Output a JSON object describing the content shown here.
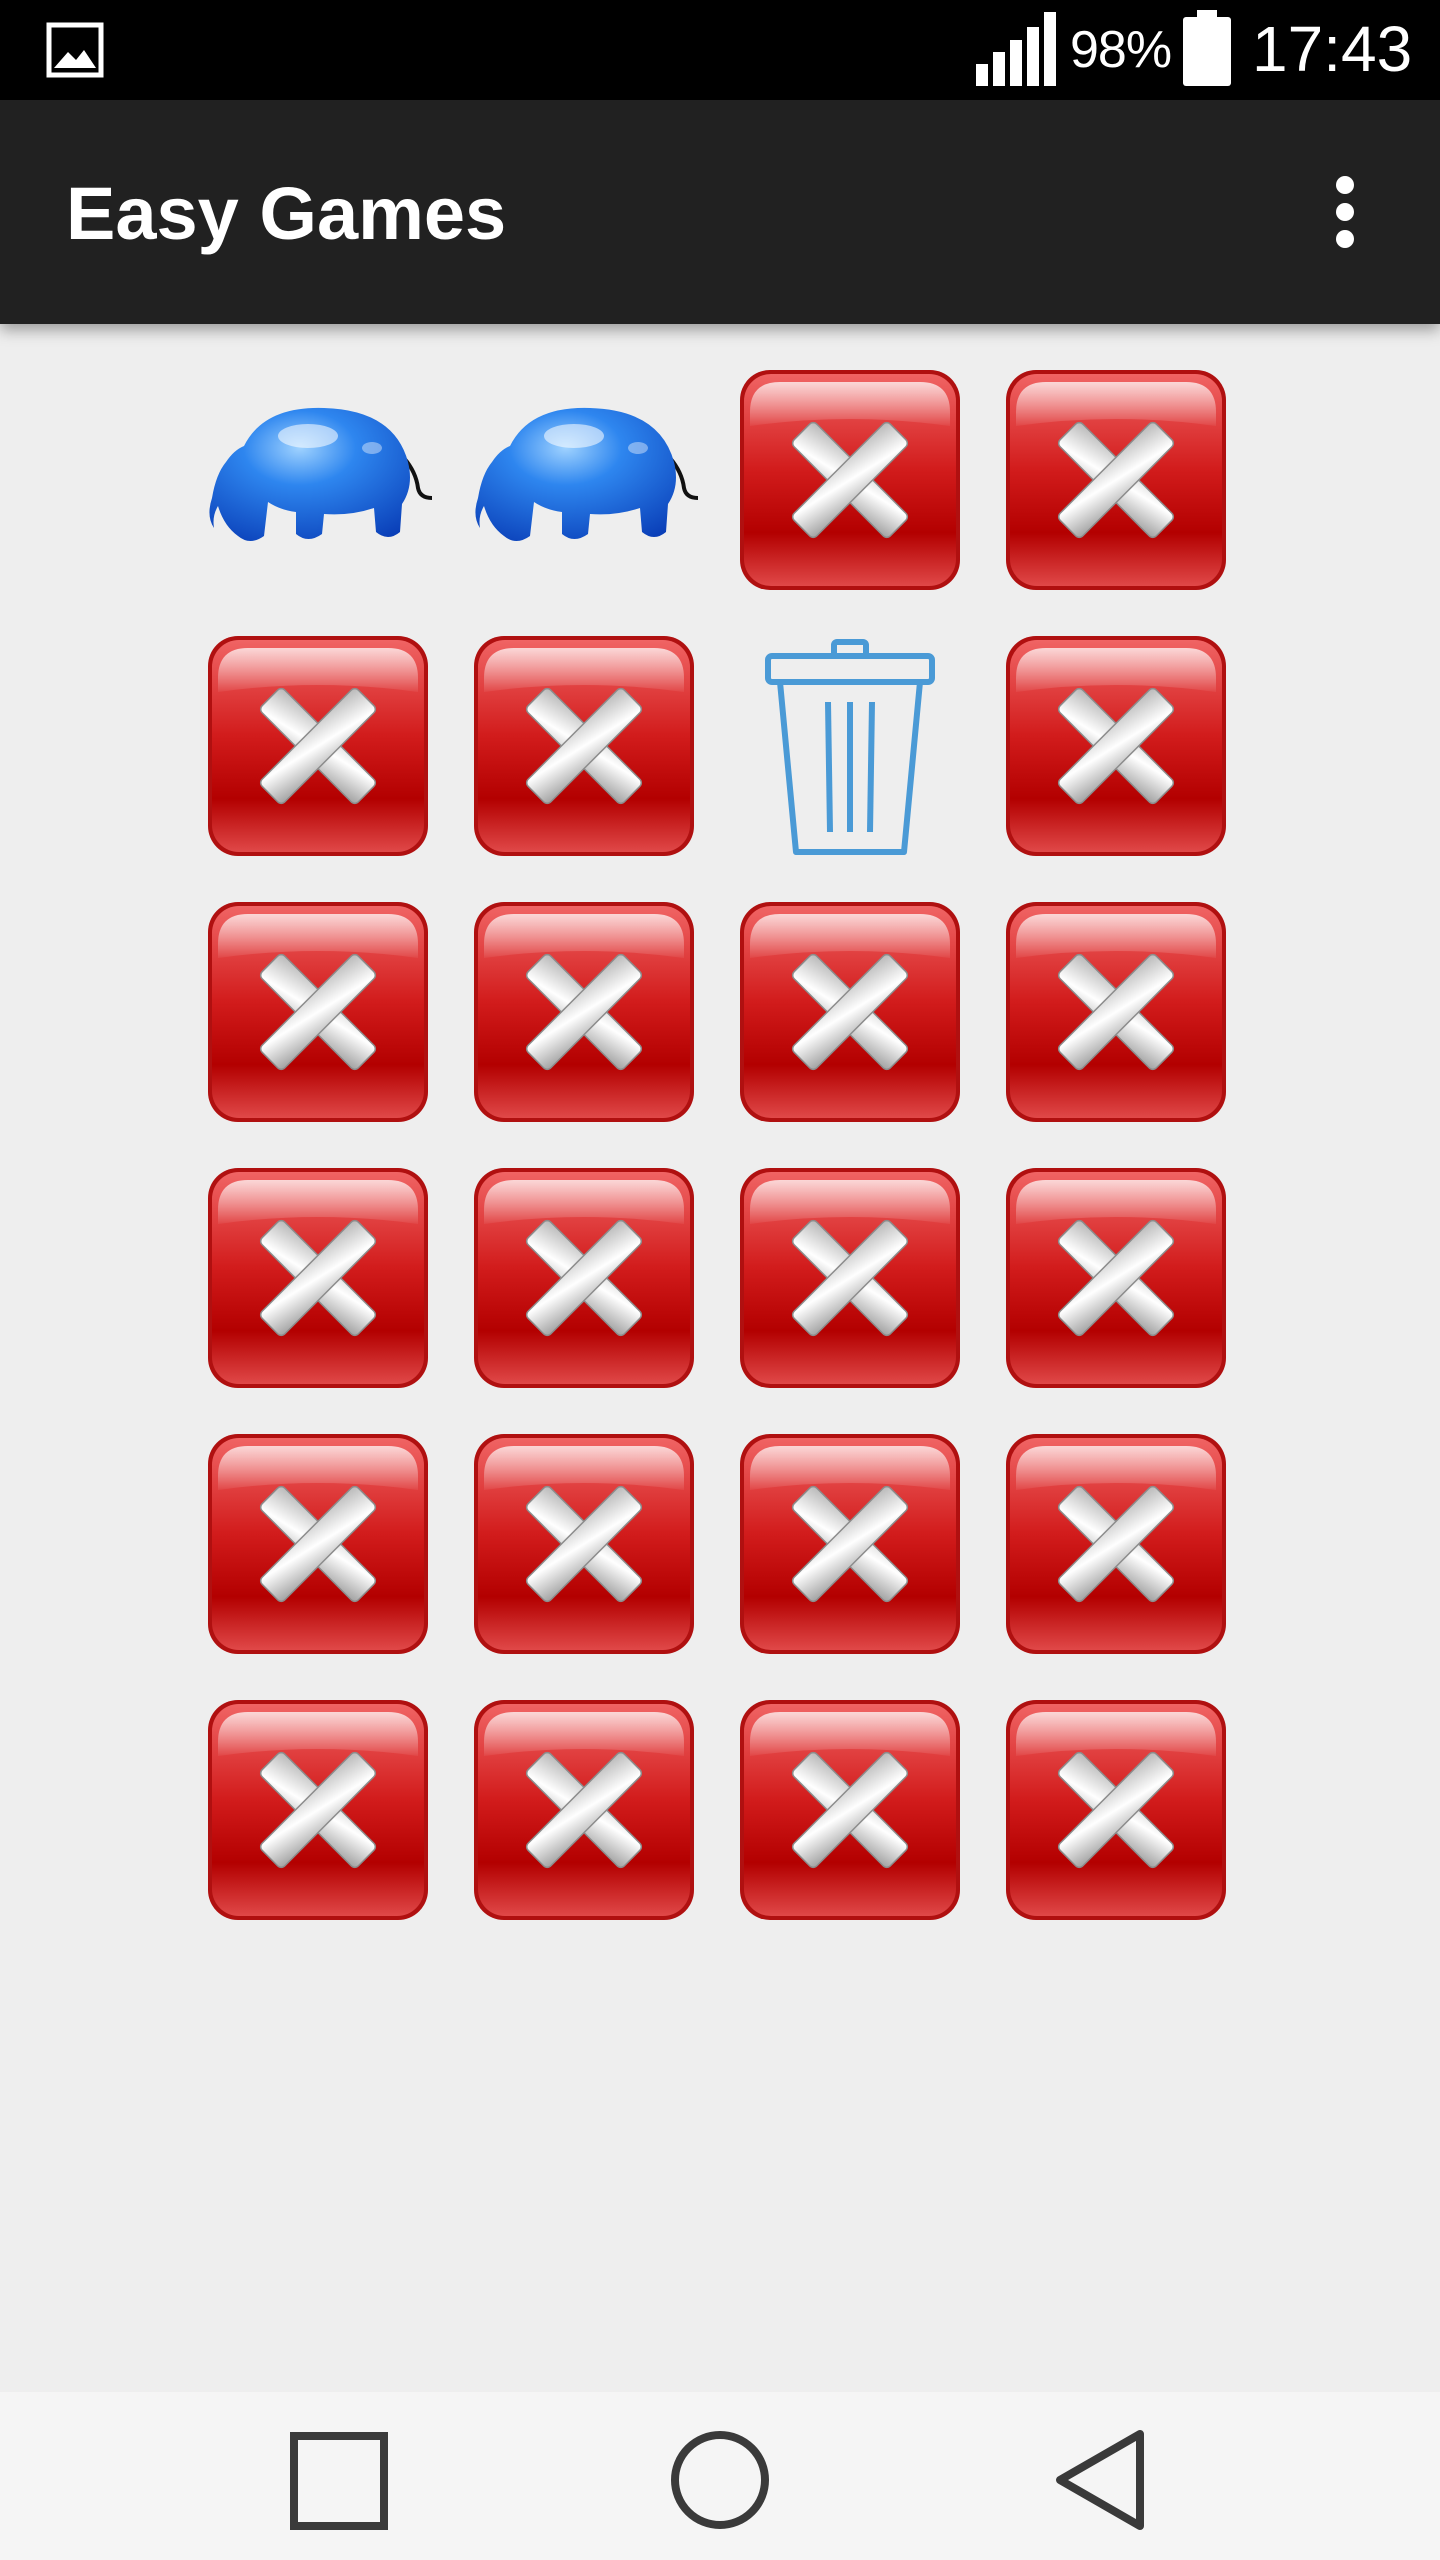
{
  "status_bar": {
    "battery": "98%",
    "time": "17:43",
    "icons": [
      "gallery-icon",
      "signal-icon",
      "battery-icon"
    ]
  },
  "app_bar": {
    "title": "Easy Games",
    "menu_icon": "overflow-menu-icon"
  },
  "board": {
    "columns": 4,
    "rows": 6,
    "tiles": [
      "elephant",
      "elephant",
      "hidden",
      "hidden",
      "hidden",
      "hidden",
      "trash-can",
      "hidden",
      "hidden",
      "hidden",
      "hidden",
      "hidden",
      "hidden",
      "hidden",
      "hidden",
      "hidden",
      "hidden",
      "hidden",
      "hidden",
      "hidden",
      "hidden",
      "hidden",
      "hidden",
      "hidden"
    ]
  },
  "nav_bar": {
    "buttons": [
      "recents-icon",
      "home-icon",
      "back-icon"
    ]
  },
  "colors": {
    "status_bar": "#000000",
    "app_bar": "#212121",
    "background": "#eeeeee",
    "tile_red": "#cc1a1a",
    "elephant_blue": "#1a6ee6",
    "trash_blue": "#4a9ad6",
    "nav_icon": "#3a3a3a"
  }
}
